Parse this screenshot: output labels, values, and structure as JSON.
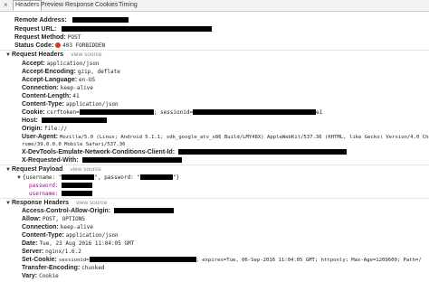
{
  "tabs": {
    "close": "×",
    "items": [
      "Headers",
      "Preview",
      "Response",
      "Cookies",
      "Timing"
    ]
  },
  "general": {
    "remote_address_key": "Remote Address:",
    "request_url_key": "Request URL:",
    "request_method_key": "Request Method:",
    "request_method_val": "POST",
    "status_code_key": "Status Code:",
    "status_code_val": "403 FORBIDDEN"
  },
  "request_headers": {
    "title": "Request Headers",
    "view_source": "view source",
    "accept_k": "Accept:",
    "accept_v": "application/json",
    "accept_encoding_k": "Accept-Encoding:",
    "accept_encoding_v": "gzip, deflate",
    "accept_language_k": "Accept-Language:",
    "accept_language_v": "en-US",
    "connection_k": "Connection:",
    "connection_v": "keep-alive",
    "content_length_k": "Content-Length:",
    "content_length_v": "41",
    "content_type_k": "Content-Type:",
    "content_type_v": "application/json",
    "cookie_k": "Cookie:",
    "cookie_v1": "csrftoken=",
    "cookie_v2": "; sessionid=",
    "cookie_v3": "e1",
    "host_k": "Host:",
    "origin_k": "Origin:",
    "origin_v": "file://",
    "user_agent_k": "User-Agent:",
    "user_agent_v1": "Mozilla/5.0 (Linux; Android 5.1.1; sdk_google_atv_x86 Build/LMY48X) AppleWebKit/537.36 (KHTML, like Gecko) Version/4.0 Ch",
    "user_agent_v2": "rome/39.0.0.0 Mobile Safari/537.36",
    "devtools_k": "X-DevTools-Emulate-Network-Conditions-Client-Id:",
    "requested_with_k": "X-Requested-With:"
  },
  "request_payload": {
    "title": "Request Payload",
    "view_source": "view source",
    "summary_1": "{username: \"",
    "summary_2": "\", password: \"",
    "summary_3": "\"}",
    "password_k": "password:",
    "username_k": "username:"
  },
  "response_headers": {
    "title": "Response Headers",
    "view_source": "view source",
    "acao_k": "Access-Control-Allow-Origin:",
    "allow_k": "Allow:",
    "allow_v": "POST, OPTIONS",
    "connection_k": "Connection:",
    "connection_v": "keep-alive",
    "content_type_k": "Content-Type:",
    "content_type_v": "application/json",
    "date_k": "Date:",
    "date_v": "Tue, 23 Aug 2016 11:04:05 GMT",
    "server_k": "Server:",
    "server_v": "nginx/1.6.2",
    "set_cookie_k": "Set-Cookie:",
    "set_cookie_v1": "sessionid=",
    "set_cookie_v2": "; expires=Tue, 06-Sep-2016 11:04:05 GMT; httponly; Max-Age=1209600; Path=/",
    "transfer_encoding_k": "Transfer-Encoding:",
    "transfer_encoding_v": "chunked",
    "vary_k": "Vary:",
    "vary_v": "Cookie"
  },
  "colors": {
    "status_dot": "#d23a2a",
    "payload_key": "#881280",
    "redaction": "#000000"
  }
}
